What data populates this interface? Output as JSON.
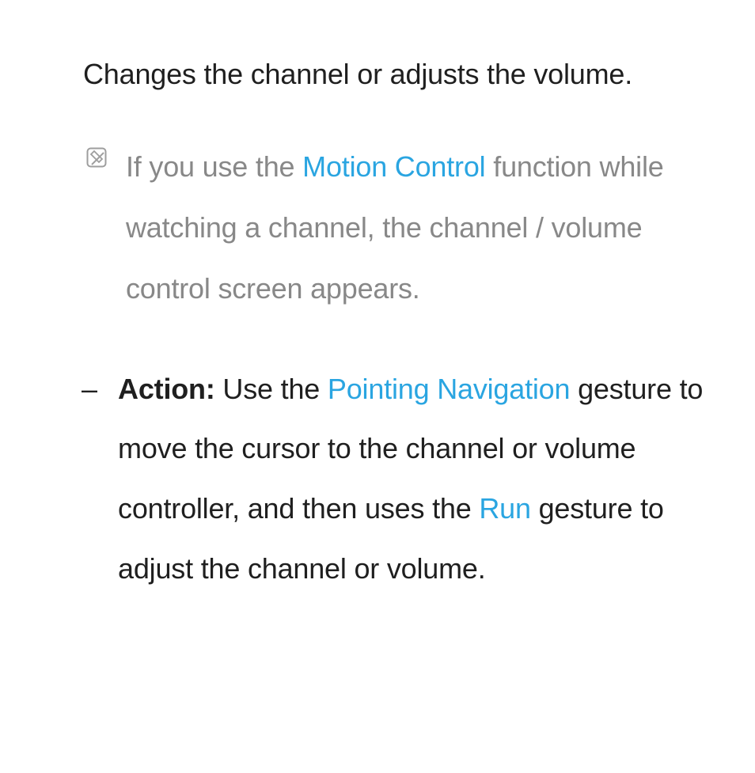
{
  "intro": "Changes the channel or adjusts the volume.",
  "note": {
    "pre": "If you use the ",
    "highlight": "Motion Control",
    "post": " function while watching a channel, the channel / volume control screen appears."
  },
  "action": {
    "dash": "–",
    "label": "Action:",
    "t1": " Use the ",
    "h1": "Pointing Navigation",
    "t2": " gesture to move the cursor to the channel or volume controller, and then uses the ",
    "h2": "Run",
    "t3": " gesture to adjust the channel or volume."
  }
}
